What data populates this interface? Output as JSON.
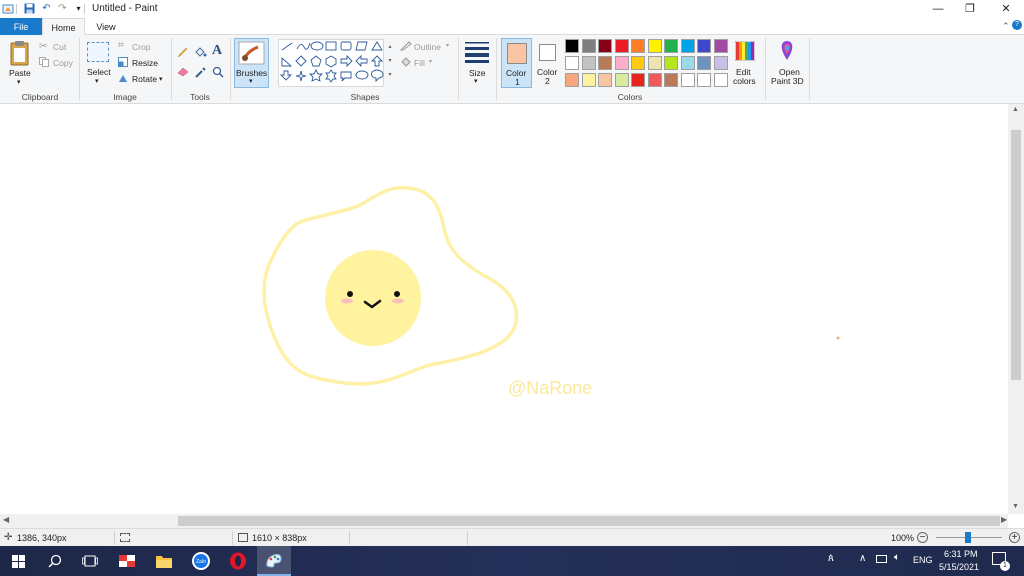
{
  "window": {
    "title": "Untitled - Paint",
    "controls": [
      "—",
      "❐",
      "✕"
    ]
  },
  "menu": {
    "file": "File",
    "home": "Home",
    "view": "View"
  },
  "ribbon": {
    "clipboard": {
      "paste": "Paste",
      "cut": "Cut",
      "copy": "Copy",
      "label": "Clipboard"
    },
    "image": {
      "select": "Select",
      "crop": "Crop",
      "resize": "Resize",
      "rotate": "Rotate",
      "label": "Image"
    },
    "tools": {
      "label": "Tools"
    },
    "brushes": {
      "label": "Brushes"
    },
    "shapes": {
      "outline": "Outline",
      "fill": "Fill",
      "label": "Shapes"
    },
    "size": {
      "label": "Size"
    },
    "color1": {
      "label": "Color",
      "num": "1",
      "value": "#f9c5a4"
    },
    "color2": {
      "label": "Color",
      "num": "2",
      "value": "#ffffff"
    },
    "colors": {
      "label": "Colors",
      "row1": [
        "#000000",
        "#7f7f7f",
        "#880015",
        "#ed1c24",
        "#ff7f27",
        "#fff200",
        "#22b14c",
        "#00a2e8",
        "#3f48cc",
        "#a349a4"
      ],
      "row2": [
        "#ffffff",
        "#c3c3c3",
        "#b97a57",
        "#ffaec9",
        "#ffc90e",
        "#efe4b0",
        "#b5e61d",
        "#99d9ea",
        "#7092be",
        "#c8bfe7"
      ],
      "row3": [
        "#f7a77b",
        "#fbf2a1",
        "#f9c5a4",
        "#d8ea9b",
        "#e8251b",
        "#ef5b5b",
        "#b97a57",
        "#ffffff",
        "#ffffff",
        "#ffffff"
      ]
    },
    "edit_colors": {
      "line1": "Edit",
      "line2": "colors"
    },
    "paint3d": {
      "line1": "Open",
      "line2": "Paint 3D"
    }
  },
  "canvas": {
    "watermark": "@NaRone",
    "egg_white": "#fff0a8",
    "yolk": "#fff3a0"
  },
  "status": {
    "cursor_pos": "1386, 340px",
    "canvas_size": "1610 × 838px",
    "zoom": "100%"
  },
  "taskbar": {
    "language": "ENG",
    "time": "6:31 PM",
    "date": "5/15/2021",
    "notification_count": "1"
  }
}
